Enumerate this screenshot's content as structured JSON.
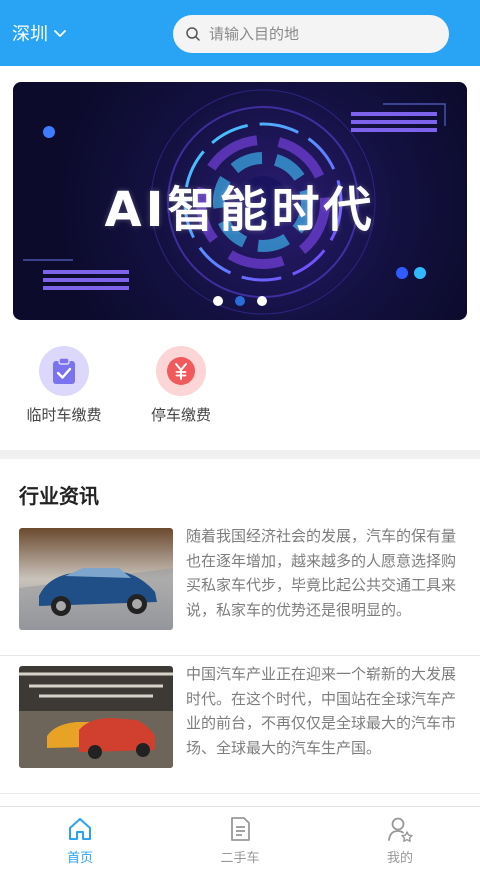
{
  "header": {
    "city": "深圳",
    "search_placeholder": "请输入目的地"
  },
  "banner": {
    "title": "AI智能时代",
    "slide_count": 3,
    "active_slide": 2
  },
  "actions": [
    {
      "label": "临时车缴费",
      "icon": "clipboard-check-icon",
      "color": "#7b72ee"
    },
    {
      "label": "停车缴费",
      "icon": "yuan-icon",
      "color": "#f05a5a"
    }
  ],
  "news": {
    "section_title": "行业资讯",
    "items": [
      {
        "text": "随着我国经济社会的发展，汽车的保有量也在逐年增加，越来越多的人愿意选择购买私家车代步，毕竟比起公共交通工具来说，私家车的优势还是很明显的。"
      },
      {
        "text": "中国汽车产业正在迎来一个崭新的大发展时代。在这个时代，中国站在全球汽车产业的前台，不再仅仅是全球最大的汽车市场、全球最大的汽车生产国。"
      }
    ]
  },
  "tabbar": {
    "tabs": [
      {
        "label": "首页",
        "icon": "home-icon",
        "active": true
      },
      {
        "label": "二手车",
        "icon": "document-icon",
        "active": false
      },
      {
        "label": "我的",
        "icon": "user-star-icon",
        "active": false
      }
    ]
  },
  "colors": {
    "accent": "#29a4f5",
    "divider": "#f0f0f0"
  }
}
